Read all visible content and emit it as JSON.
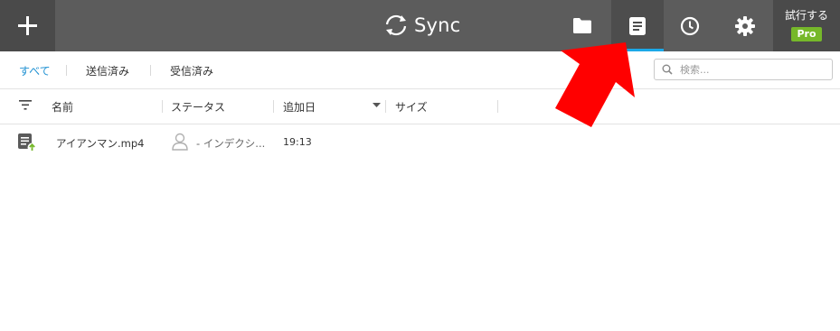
{
  "app": {
    "title": "Sync",
    "trial_label": "試行する",
    "pro_badge": "Pro"
  },
  "nav": [
    {
      "name": "folders",
      "icon": "folder-icon",
      "active": false
    },
    {
      "name": "transfers",
      "icon": "document-list-icon",
      "active": true
    },
    {
      "name": "history",
      "icon": "clock-icon",
      "active": false
    },
    {
      "name": "settings",
      "icon": "gear-icon",
      "active": false
    }
  ],
  "filters": {
    "all": "すべて",
    "sent": "送信済み",
    "received": "受信済み",
    "active": "all"
  },
  "search": {
    "placeholder": "検索..."
  },
  "columns": {
    "name": "名前",
    "status": "ステータス",
    "added": "追加日",
    "size": "サイズ"
  },
  "rows": [
    {
      "name": "アイアンマン.mp4",
      "status": "- インデクシ...",
      "added": "19:13",
      "size": ""
    }
  ],
  "colors": {
    "titlebar": "#5c5c5c",
    "accent": "#1ca9e8",
    "link": "#1e90d2",
    "pro": "#76b82a",
    "annotation_arrow": "#ff0000"
  }
}
